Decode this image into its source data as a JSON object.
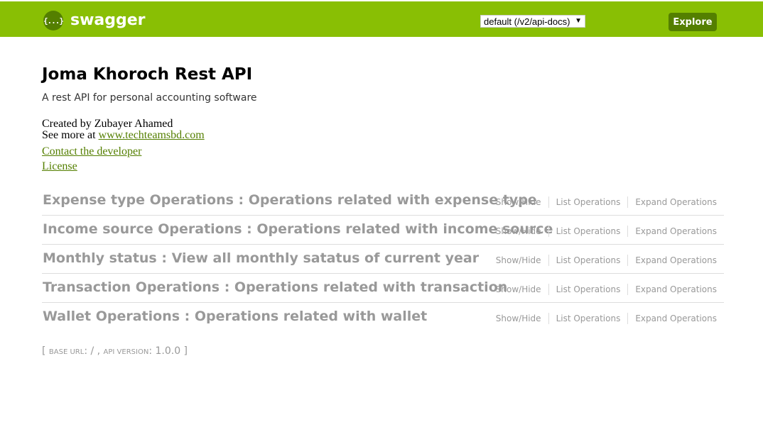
{
  "header": {
    "logo_icon": "{...}",
    "logo_text": "swagger",
    "spec_select": "default (/v2/api-docs)",
    "spec_select_arrow": "▼",
    "explore_label": "Explore",
    "bg_color": "#89bf04"
  },
  "info": {
    "title": "Joma Khoroch Rest API",
    "description": "A rest API for personal accounting software",
    "created_by": "Created by Zubayer Ahamed",
    "see_more_prefix": "See more at ",
    "see_more_link": "www.techteamsbd.com",
    "contact_link": "Contact the developer",
    "license_link": "License"
  },
  "resources": [
    {
      "name": "Expense type Operations : Operations related with expense type",
      "show_hide": "Show/Hide",
      "list_ops": "List Operations",
      "expand_ops": "Expand Operations"
    },
    {
      "name": "Income source Operations : Operations related with income source",
      "show_hide": "Show/Hide",
      "list_ops": "List Operations",
      "expand_ops": "Expand Operations"
    },
    {
      "name": "Monthly status : View all monthly satatus of current year",
      "show_hide": "Show/Hide",
      "list_ops": "List Operations",
      "expand_ops": "Expand Operations"
    },
    {
      "name": "Transaction Operations : Operations related with transaction",
      "show_hide": "Show/Hide",
      "list_ops": "List Operations",
      "expand_ops": "Expand Operations"
    },
    {
      "name": "Wallet Operations : Operations related with wallet",
      "show_hide": "Show/Hide",
      "list_ops": "List Operations",
      "expand_ops": "Expand Operations"
    }
  ],
  "footer": {
    "open_bracket": "[ ",
    "base_url_label": "base url",
    "base_url_value": ": / , ",
    "api_version_label": "api version",
    "api_version_value": ": 1.0.0 ]"
  }
}
